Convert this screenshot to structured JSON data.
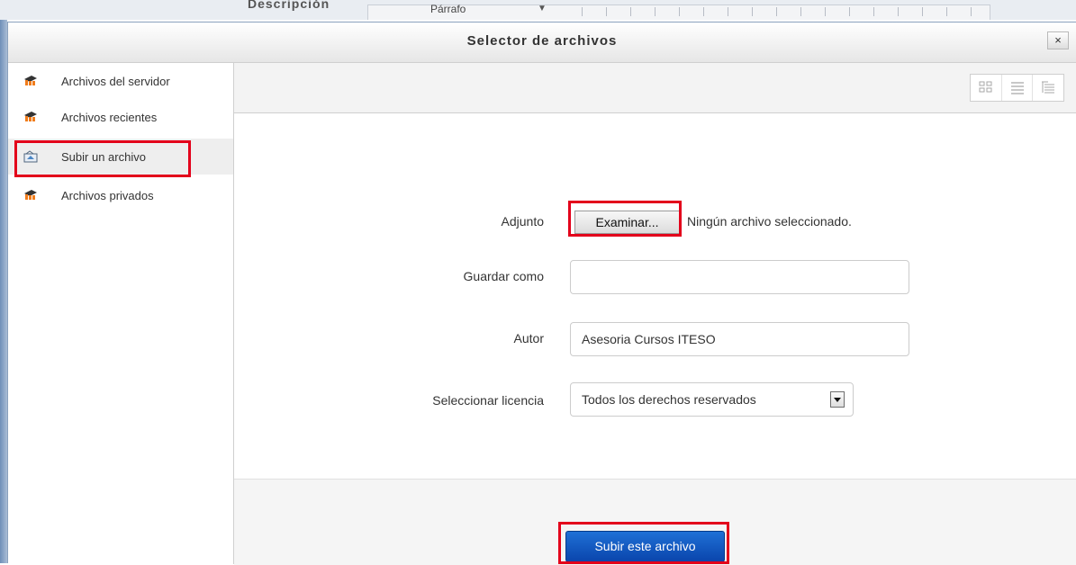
{
  "background": {
    "heading": "Descripción",
    "paragraph_format": "Párrafo"
  },
  "dialog": {
    "title": "Selector de archivos",
    "close_label": "×"
  },
  "sidebar": {
    "items": [
      {
        "label": "Archivos del servidor",
        "icon": "moodle-icon"
      },
      {
        "label": "Archivos recientes",
        "icon": "moodle-icon"
      },
      {
        "label": "Subir un archivo",
        "icon": "upload-icon",
        "active": true
      },
      {
        "label": "Archivos privados",
        "icon": "moodle-icon"
      }
    ]
  },
  "view_buttons": [
    "icons-view-icon",
    "list-view-icon",
    "tree-view-icon"
  ],
  "form": {
    "attachment_label": "Adjunto",
    "browse_label": "Examinar...",
    "no_file_text": "Ningún archivo seleccionado.",
    "save_as_label": "Guardar como",
    "save_as_value": "",
    "author_label": "Autor",
    "author_value": "Asesoria Cursos ITESO",
    "license_label": "Seleccionar licencia",
    "license_value": "Todos los derechos reservados"
  },
  "footer": {
    "upload_label": "Subir este archivo"
  },
  "colors": {
    "highlight": "#e3001b",
    "primary_button": "#0a45ac",
    "moodle_orange": "#f07c1b"
  }
}
